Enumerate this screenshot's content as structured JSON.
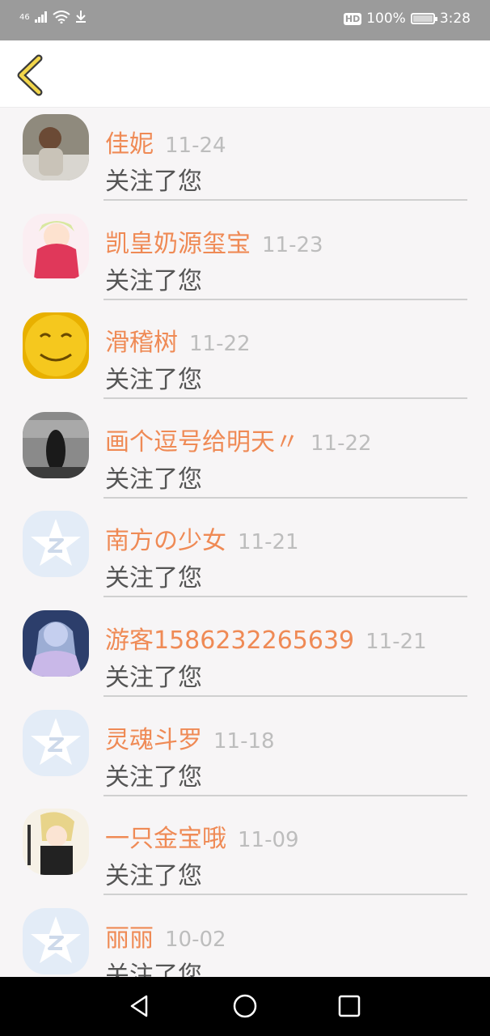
{
  "status_bar": {
    "signal": "46",
    "battery_percent": "100%",
    "hd_badge": "HD",
    "time": "3:28"
  },
  "header": {
    "back_icon": "chevron-left-icon"
  },
  "colors": {
    "name": "#ef8a55",
    "date": "#bdbdbd",
    "action": "#555555",
    "divider": "#d0d0d0"
  },
  "followers": [
    {
      "name": "佳妮",
      "date": "11-24",
      "action": "关注了您",
      "avatar": "photo-avatar"
    },
    {
      "name": "凯皇奶源玺宝",
      "date": "11-23",
      "action": "关注了您",
      "avatar": "anime-avatar"
    },
    {
      "name": "滑稽树",
      "date": "11-22",
      "action": "关注了您",
      "avatar": "smiley-avatar"
    },
    {
      "name": "画个逗号给明天〃",
      "date": "11-22",
      "action": "关注了您",
      "avatar": "photo-avatar"
    },
    {
      "name": "南方の少女",
      "date": "11-21",
      "action": "关注了您",
      "avatar": "default-avatar"
    },
    {
      "name": "游客1586232265639",
      "date": "11-21",
      "action": "关注了您",
      "avatar": "anime-avatar"
    },
    {
      "name": "灵魂斗罗",
      "date": "11-18",
      "action": "关注了您",
      "avatar": "default-avatar"
    },
    {
      "name": "一只金宝哦",
      "date": "11-09",
      "action": "关注了您",
      "avatar": "anime-avatar"
    },
    {
      "name": "丽丽",
      "date": "10-02",
      "action": "关注了您",
      "avatar": "default-avatar"
    }
  ],
  "nav_bar": {
    "back": "back-triangle-icon",
    "home": "home-circle-icon",
    "recents": "recents-square-icon"
  }
}
